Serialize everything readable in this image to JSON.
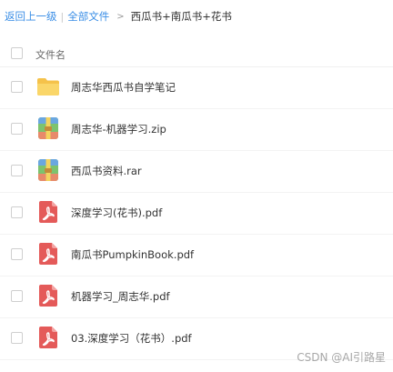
{
  "breadcrumb": {
    "back": "返回上一级",
    "separator": "|",
    "all_files": "全部文件",
    "arrow": ">",
    "current": "西瓜书+南瓜书+花书"
  },
  "list": {
    "header": "文件名",
    "files": [
      {
        "name": "周志华西瓜书自学笔记",
        "icon": "folder-icon"
      },
      {
        "name": "周志华-机器学习.zip",
        "icon": "archive-icon"
      },
      {
        "name": "西瓜书资料.rar",
        "icon": "archive-icon"
      },
      {
        "name": "深度学习(花书).pdf",
        "icon": "pdf-icon"
      },
      {
        "name": "南瓜书PumpkinBook.pdf",
        "icon": "pdf-icon"
      },
      {
        "name": "机器学习_周志华.pdf",
        "icon": "pdf-icon"
      },
      {
        "name": "03.深度学习（花书）.pdf",
        "icon": "pdf-icon"
      }
    ]
  },
  "watermark": "CSDN @AI引路星",
  "colors": {
    "link": "#3a8ee6",
    "folder": "#f8cf5b",
    "pdf": "#e45a59"
  }
}
